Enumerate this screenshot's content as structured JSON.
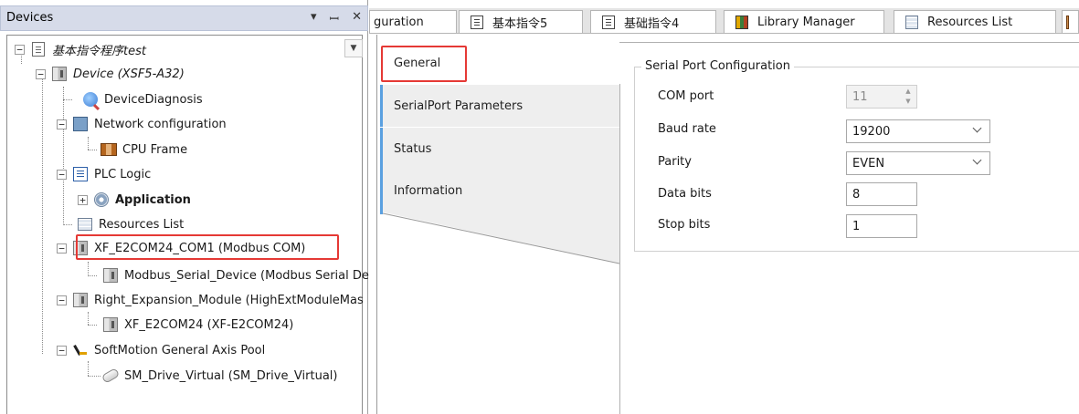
{
  "devices_panel": {
    "title": "Devices",
    "header_icons": [
      "chevron-down-icon",
      "pin-icon",
      "close-icon"
    ]
  },
  "tree": [
    {
      "label": "基本指令程序test",
      "style": "italic",
      "icon": "project-icon",
      "expander": "−"
    },
    {
      "label": "Device (XSF5-A32)",
      "style": "italic",
      "icon": "device-icon",
      "expander": "−"
    },
    {
      "label": "DeviceDiagnosis",
      "icon": "diagnosis-icon"
    },
    {
      "label": "Network configuration",
      "icon": "network-icon",
      "expander": "−"
    },
    {
      "label": "CPU Frame",
      "icon": "cpu-frame-icon"
    },
    {
      "label": "PLC Logic",
      "icon": "plc-logic-icon",
      "expander": "−"
    },
    {
      "label": "Application",
      "style": "bold",
      "icon": "application-gear-icon",
      "expander": "+"
    },
    {
      "label": "Resources List",
      "icon": "resources-list-icon"
    },
    {
      "label": "XF_E2COM24_COM1 (Modbus COM)",
      "icon": "device-icon",
      "expander": "−",
      "highlighted": true
    },
    {
      "label": "Modbus_Serial_Device (Modbus Serial De",
      "icon": "device-icon"
    },
    {
      "label": "Right_Expansion_Module (HighExtModuleMas",
      "icon": "device-icon",
      "expander": "−"
    },
    {
      "label": "XF_E2COM24 (XF-E2COM24)",
      "icon": "device-icon"
    },
    {
      "label": "SoftMotion General Axis Pool",
      "icon": "axis-pool-icon",
      "expander": "−"
    },
    {
      "label": "SM_Drive_Virtual (SM_Drive_Virtual)",
      "icon": "drive-icon"
    }
  ],
  "tabs": [
    {
      "label": "guration",
      "icon": ""
    },
    {
      "label": "基本指令5",
      "icon": "document-icon"
    },
    {
      "label": "基础指令4",
      "icon": "document-icon"
    },
    {
      "label": "Library Manager",
      "icon": "library-icon"
    },
    {
      "label": "Resources List",
      "icon": "resources-list-icon"
    },
    {
      "label": "",
      "icon": "cpu-frame-icon"
    }
  ],
  "side_tabs": [
    {
      "label": "General",
      "active": true
    },
    {
      "label": "SerialPort Parameters",
      "active": false
    },
    {
      "label": "Status",
      "active": false
    },
    {
      "label": "Information",
      "active": false
    }
  ],
  "serial_config": {
    "group_title": "Serial Port Configuration",
    "fields": [
      {
        "label": "COM port",
        "value": "11",
        "control": "spinner",
        "disabled": true
      },
      {
        "label": "Baud rate",
        "value": "19200",
        "control": "dropdown"
      },
      {
        "label": "Parity",
        "value": "EVEN",
        "control": "dropdown"
      },
      {
        "label": "Data bits",
        "value": "8",
        "control": "text"
      },
      {
        "label": "Stop bits",
        "value": "1",
        "control": "text"
      }
    ]
  },
  "colors": {
    "highlight": "#e53935",
    "side_tab_accent": "#5aa0e0",
    "panel_header": "#d6dbe9"
  }
}
